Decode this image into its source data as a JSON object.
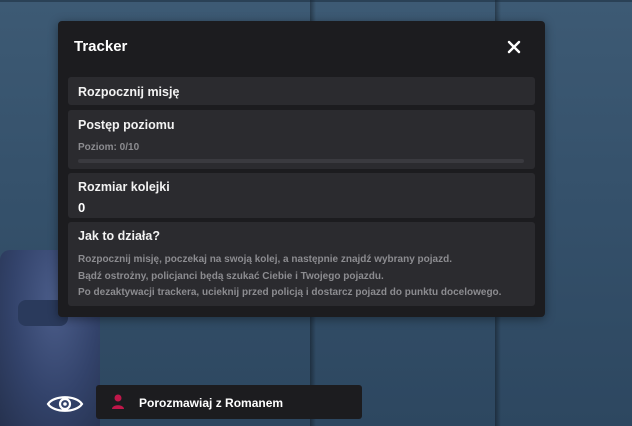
{
  "tracker": {
    "title": "Tracker",
    "start_mission": "Rozpocznij misję",
    "progress": {
      "title": "Postęp poziomu",
      "label": "Poziom: 0/10",
      "level": 0,
      "max_level": 10
    },
    "queue": {
      "title": "Rozmiar kolejki",
      "value": "0"
    },
    "how_it_works": {
      "title": "Jak to działa?",
      "lines": [
        "Rozpocznij misję, poczekaj na swoją kolej, a następnie znajdź wybrany pojazd.",
        "Bądź ostrożny, policjanci będą szukać Ciebie i Twojego pojazdu.",
        "Po dezaktywacji trackera, ucieknij przed policją i dostarcz pojazd do punktu docelowego."
      ]
    }
  },
  "interaction": {
    "label": "Porozmawiaj z Romanem"
  },
  "icons": {
    "close": "close-icon",
    "eye": "eye-icon",
    "person": "person-icon"
  },
  "colors": {
    "accent": "#c0174a",
    "panel": "#1c1c1f",
    "card": "#2b2b2f",
    "muted_text": "#8c8c90"
  }
}
